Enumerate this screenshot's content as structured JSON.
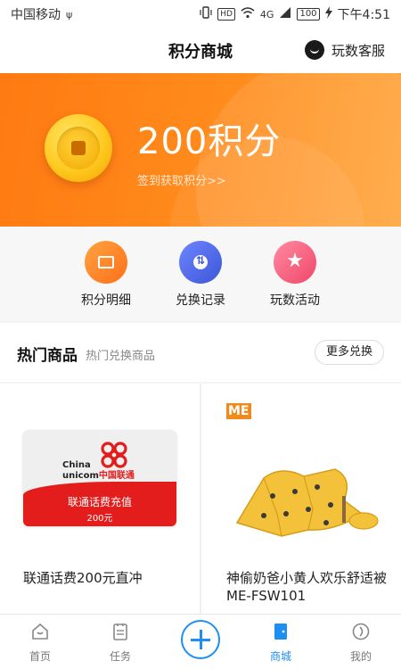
{
  "status_bar": {
    "carrier": "中国移动",
    "usb_icon": "ψ",
    "hd": "HD",
    "network": "4G",
    "battery": "100",
    "time": "下午4:51"
  },
  "header": {
    "title": "积分商城",
    "service_label": "玩数客服"
  },
  "banner": {
    "points": "200积分",
    "earn_link": "签到获取积分>>"
  },
  "quick_actions": [
    {
      "label": "积分明细",
      "icon": "ticket-icon",
      "color": "#ff8a2a"
    },
    {
      "label": "兑换记录",
      "icon": "exchange-icon",
      "color": "#4a63e0"
    },
    {
      "label": "玩数活动",
      "icon": "star-icon",
      "color": "#f4587a"
    }
  ],
  "hot": {
    "title": "热门商品",
    "subtitle": "热门兑换商品",
    "more_button": "更多兑换"
  },
  "products": [
    {
      "name": "联通话费200元直冲",
      "card_brand_en1": "China",
      "card_brand_en2": "unicom",
      "card_brand_cn": "中国联通",
      "card_title": "联通话费充值",
      "card_amount": "200元"
    },
    {
      "name": "神偷奶爸小黄人欢乐舒适被ME-FSW101",
      "badge": "ME"
    }
  ],
  "tabbar": {
    "items": [
      {
        "label": "首页",
        "icon": "home-icon"
      },
      {
        "label": "任务",
        "icon": "task-icon"
      },
      {
        "label": "",
        "icon": "plus-icon"
      },
      {
        "label": "商城",
        "icon": "mall-icon"
      },
      {
        "label": "我的",
        "icon": "profile-icon"
      }
    ],
    "active": "商城",
    "accent": "#1e8ef2"
  }
}
